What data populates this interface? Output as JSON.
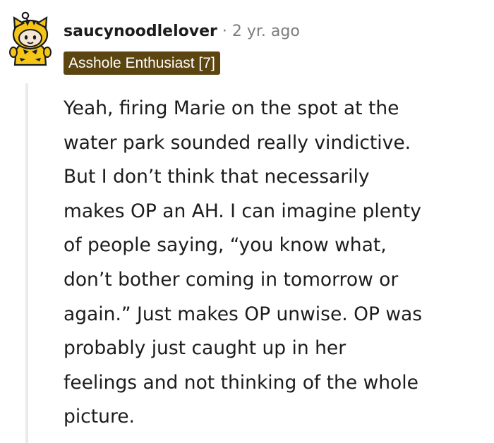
{
  "comment": {
    "author": "saucynoodlelover",
    "separator": "·",
    "timestamp": "2 yr. ago",
    "flair": "Asshole Enthusiast [7]",
    "avatar_icon": "tiger-costume-snoo-avatar-icon",
    "flair_color": "#5c4511",
    "body_lines": [
      "Yeah, firing Marie on the spot at the",
      "water park sounded really vindictive.",
      "But I don’t think that necessarily",
      "makes OP an AH. I can imagine plenty",
      "of people saying, “you know what,",
      "don’t bother coming in tomorrow or",
      "again.” Just makes OP unwise. OP was",
      "probably just caught up in her",
      "feelings and not thinking of the whole",
      "picture."
    ]
  }
}
